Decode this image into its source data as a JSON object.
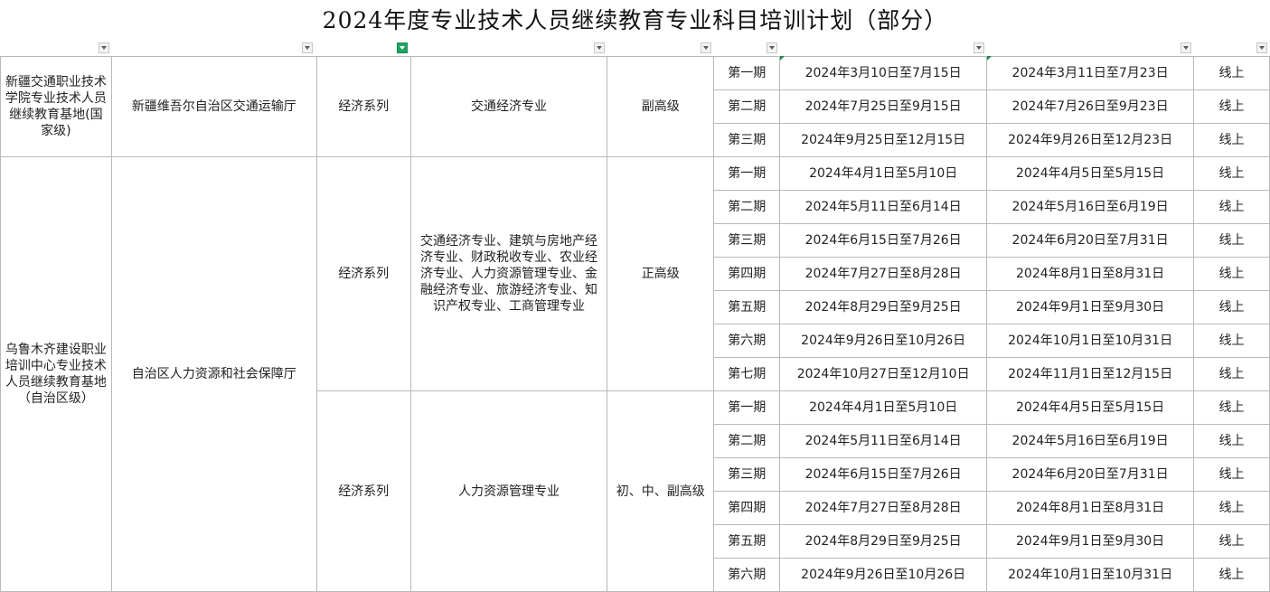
{
  "title": "2024年度专业技术人员继续教育专业科目培训计划（部分）",
  "filter_icon": "filter-dropdown-icon",
  "accent": "#21a366",
  "blocks": [
    {
      "institution": "新疆交通职业技术学院专业技术人员继续教育基地(国家级)",
      "department": "新疆维吾尔自治区交通运输厅",
      "series": "经济系列",
      "specialty": "交通经济专业",
      "level": "副高级",
      "periods": [
        [
          "第一期",
          "2024年3月10日至7月15日",
          "2024年3月11日至7月23日",
          "线上"
        ],
        [
          "第二期",
          "2024年7月25日至9月15日",
          "2024年7月26日至9月23日",
          "线上"
        ],
        [
          "第三期",
          "2024年9月25日至12月15日",
          "2024年9月26日至12月23日",
          "线上"
        ]
      ]
    },
    {
      "institution": "乌鲁木齐建设职业培训中心专业技术人员继续教育基地（自治区级）",
      "department": "自治区人力资源和社会保障厅",
      "groups": [
        {
          "series": "经济系列",
          "specialty": "交通经济专业、建筑与房地产经济专业、财政税收专业、农业经济专业、人力资源管理专业、金融经济专业、旅游经济专业、知识产权专业、工商管理专业",
          "level": "正高级",
          "periods": [
            [
              "第一期",
              "2024年4月1日至5月10日",
              "2024年4月5日至5月15日",
              "线上"
            ],
            [
              "第二期",
              "2024年5月11日至6月14日",
              "2024年5月16日至6月19日",
              "线上"
            ],
            [
              "第三期",
              "2024年6月15日至7月26日",
              "2024年6月20日至7月31日",
              "线上"
            ],
            [
              "第四期",
              "2024年7月27日至8月28日",
              "2024年8月1日至8月31日",
              "线上"
            ],
            [
              "第五期",
              "2024年8月29日至9月25日",
              "2024年9月1日至9月30日",
              "线上"
            ],
            [
              "第六期",
              "2024年9月26日至10月26日",
              "2024年10月1日至10月31日",
              "线上"
            ],
            [
              "第七期",
              "2024年10月27日至12月10日",
              "2024年11月1日至12月15日",
              "线上"
            ]
          ]
        },
        {
          "series": "经济系列",
          "specialty": "人力资源管理专业",
          "level": "初、中、副高级",
          "periods": [
            [
              "第一期",
              "2024年4月1日至5月10日",
              "2024年4月5日至5月15日",
              "线上"
            ],
            [
              "第二期",
              "2024年5月11日至6月14日",
              "2024年5月16日至6月19日",
              "线上"
            ],
            [
              "第三期",
              "2024年6月15日至7月26日",
              "2024年6月20日至7月31日",
              "线上"
            ],
            [
              "第四期",
              "2024年7月27日至8月28日",
              "2024年8月1日至8月31日",
              "线上"
            ],
            [
              "第五期",
              "2024年8月29日至9月25日",
              "2024年9月1日至9月30日",
              "线上"
            ],
            [
              "第六期",
              "2024年9月26日至10月26日",
              "2024年10月1日至10月31日",
              "线上"
            ]
          ]
        }
      ]
    }
  ]
}
